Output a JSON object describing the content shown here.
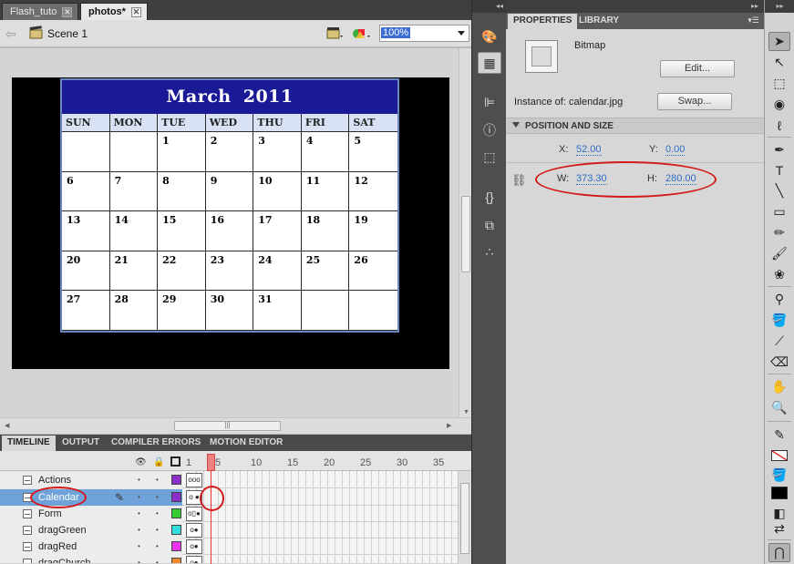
{
  "doc_tabs": [
    {
      "label": "Flash_tuto",
      "active": false
    },
    {
      "label": "photos*",
      "active": true
    }
  ],
  "edit_bar": {
    "scene_label": "Scene 1",
    "zoom_value": "100%"
  },
  "calendar": {
    "title": "March  2011",
    "days": [
      "SUN",
      "MON",
      "TUE",
      "WED",
      "THU",
      "FRI",
      "SAT"
    ],
    "cells": [
      "",
      "",
      "1",
      "2",
      "3",
      "4",
      "5",
      "6",
      "7",
      "8",
      "9",
      "10",
      "11",
      "12",
      "13",
      "14",
      "15",
      "16",
      "17",
      "18",
      "19",
      "20",
      "21",
      "22",
      "23",
      "24",
      "25",
      "26",
      "27",
      "28",
      "29",
      "30",
      "31",
      "",
      ""
    ]
  },
  "timeline": {
    "tabs": [
      "TIMELINE",
      "OUTPUT",
      "COMPILER ERRORS",
      "MOTION EDITOR"
    ],
    "frame_numbers": [
      "1",
      "5",
      "10",
      "15",
      "20",
      "25",
      "30",
      "35"
    ],
    "current_frame": 5,
    "layers": [
      {
        "name": "Actions",
        "color": "#8b2fc9",
        "selected": false,
        "keys": "ooo"
      },
      {
        "name": "Calendar",
        "color": "#8b2fc9",
        "selected": true,
        "keys": "o ●"
      },
      {
        "name": "Form",
        "color": "#33cc33",
        "selected": false,
        "keys": "o▯●"
      },
      {
        "name": "dragGreen",
        "color": "#33dddd",
        "selected": false,
        "keys": "o●"
      },
      {
        "name": "dragRed",
        "color": "#ee33ee",
        "selected": false,
        "keys": "o●"
      },
      {
        "name": "dragChurch",
        "color": "#ee8833",
        "selected": false,
        "keys": "o●"
      }
    ]
  },
  "properties": {
    "tabs": [
      "PROPERTIES",
      "LIBRARY"
    ],
    "symbol_type": "Bitmap",
    "edit_button": "Edit...",
    "instance_of_label": "Instance of:",
    "instance_of_value": "calendar.jpg",
    "swap_button": "Swap...",
    "section_title": "POSITION AND SIZE",
    "x_label": "X:",
    "x_value": "52.00",
    "y_label": "Y:",
    "y_value": "0.00",
    "w_label": "W:",
    "w_value": "373.30",
    "h_label": "H:",
    "h_value": "280.00"
  },
  "tools": [
    "selection-tool",
    "subselection-tool",
    "free-transform-tool",
    "3d-rotation-tool",
    "lasso-tool",
    "pen-tool",
    "text-tool",
    "line-tool",
    "rectangle-tool",
    "pencil-tool",
    "brush-tool",
    "deco-tool",
    "bone-tool",
    "paint-bucket-tool",
    "eyedropper-tool",
    "eraser-tool",
    "hand-tool",
    "zoom-tool",
    "stroke-color",
    "fill-color",
    "snap-to-objects"
  ],
  "colors": {
    "calendar_header": "#1a1a96",
    "annotation": "#d31a1a",
    "link_value": "#2e6ec8"
  }
}
